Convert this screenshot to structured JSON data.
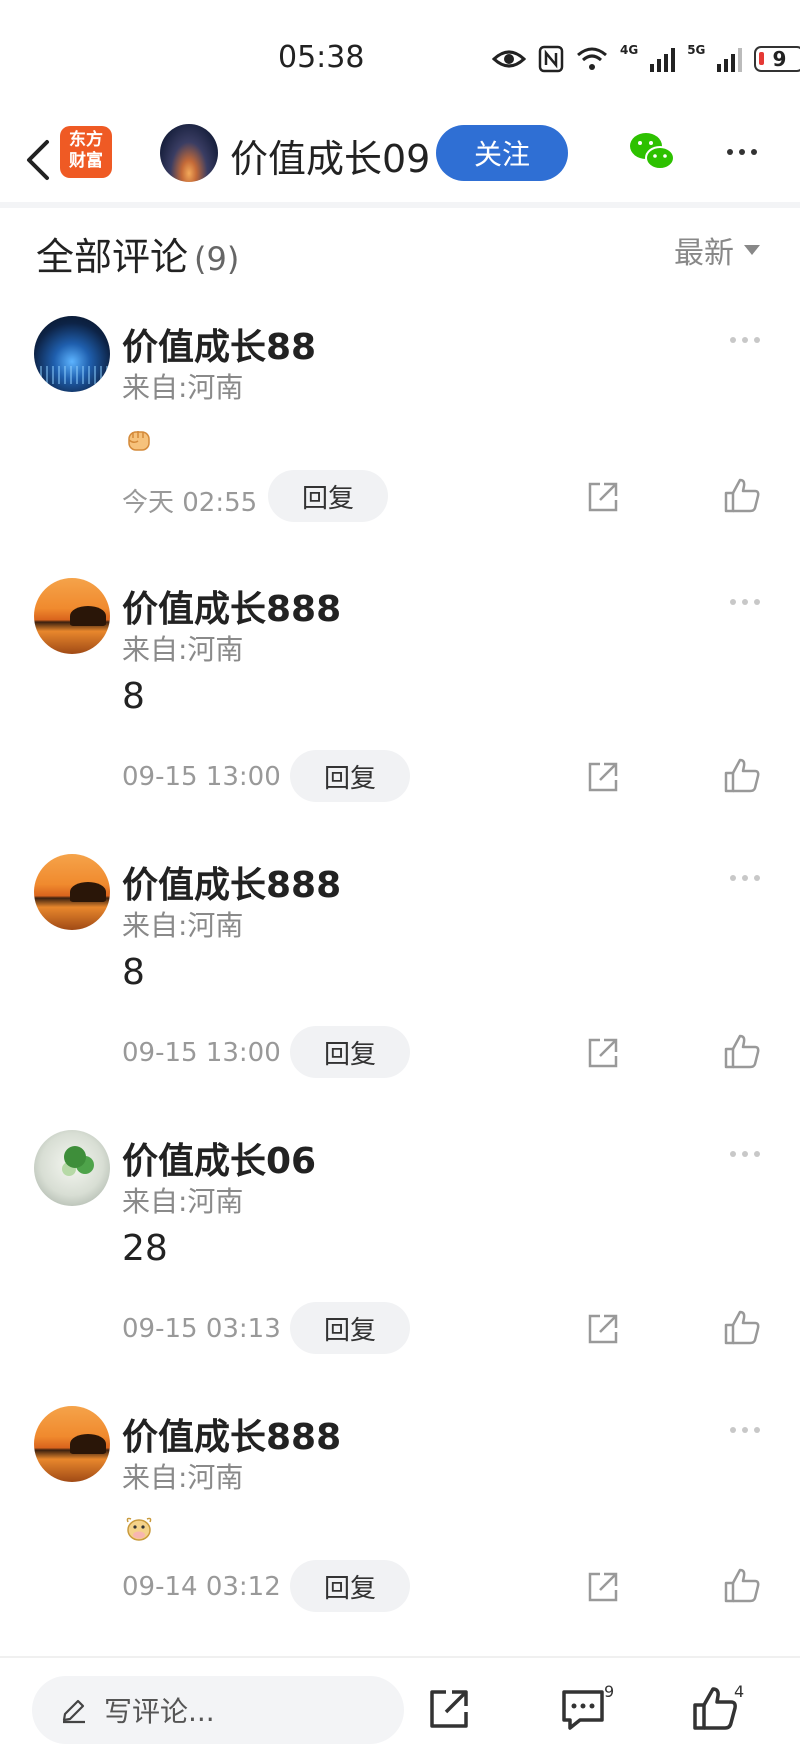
{
  "status_bar": {
    "time": "05:38",
    "net_4g": "4G",
    "net_5g": "5G",
    "battery": "9"
  },
  "header": {
    "app_logo_text": "东方\n财富",
    "author_name": "价值成长09",
    "follow_label": "关注"
  },
  "comments_header": {
    "title": "全部评论",
    "count": "(9)",
    "sort_label": "最新"
  },
  "comments": [
    {
      "name": "价值成长88",
      "location": "来自:河南",
      "content": "",
      "emoji": "fist",
      "time": "今天 02:55",
      "reply_label": "回复"
    },
    {
      "name": "价值成长888",
      "location": "来自:河南",
      "content": "8",
      "emoji": "",
      "time": "09-15 13:00",
      "reply_label": "回复"
    },
    {
      "name": "价值成长888",
      "location": "来自:河南",
      "content": "8",
      "emoji": "",
      "time": "09-15 13:00",
      "reply_label": "回复"
    },
    {
      "name": "价值成长06",
      "location": "来自:河南",
      "content": "28",
      "emoji": "",
      "time": "09-15 03:13",
      "reply_label": "回复"
    },
    {
      "name": "价值成长888",
      "location": "来自:河南",
      "content": "",
      "emoji": "cow",
      "time": "09-14 03:12",
      "reply_label": "回复"
    }
  ],
  "bottom_bar": {
    "input_placeholder": "写评论...",
    "comment_count": "9",
    "like_count": "4"
  },
  "colors": {
    "accent_blue": "#2f6fd4",
    "brand_orange": "#ef5a24",
    "wechat_green": "#2dc100"
  }
}
